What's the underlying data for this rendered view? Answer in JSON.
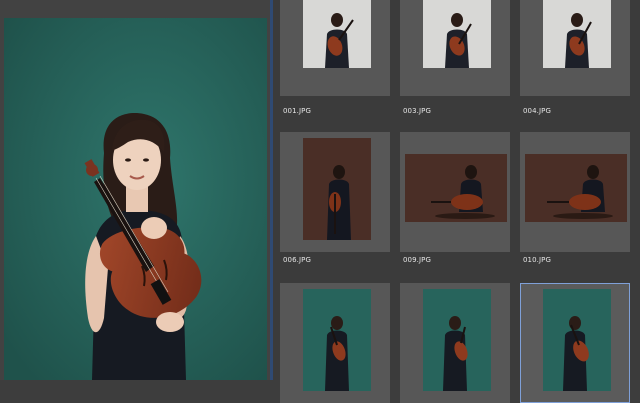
{
  "preview": {
    "background_color": "#27645c"
  },
  "grid": {
    "items": [
      {
        "filename": "001.JPG",
        "bg": "light",
        "selected": false
      },
      {
        "filename": "003.JPG",
        "bg": "light",
        "selected": false
      },
      {
        "filename": "004.JPG",
        "bg": "light",
        "selected": false
      },
      {
        "filename": "006.JPG",
        "bg": "brown-portrait",
        "selected": false
      },
      {
        "filename": "009.JPG",
        "bg": "brown-landscape",
        "selected": false
      },
      {
        "filename": "010.JPG",
        "bg": "brown-landscape",
        "selected": false
      },
      {
        "filename": "",
        "bg": "green",
        "selected": false
      },
      {
        "filename": "",
        "bg": "green",
        "selected": false
      },
      {
        "filename": "",
        "bg": "green",
        "selected": true
      }
    ]
  },
  "colors": {
    "selection_accent": "#7fa0d8",
    "divider": "#2f4a73",
    "green_backdrop": "#27645c",
    "brown_backdrop": "#4a2e26",
    "light_backdrop": "#d8d8d6"
  }
}
